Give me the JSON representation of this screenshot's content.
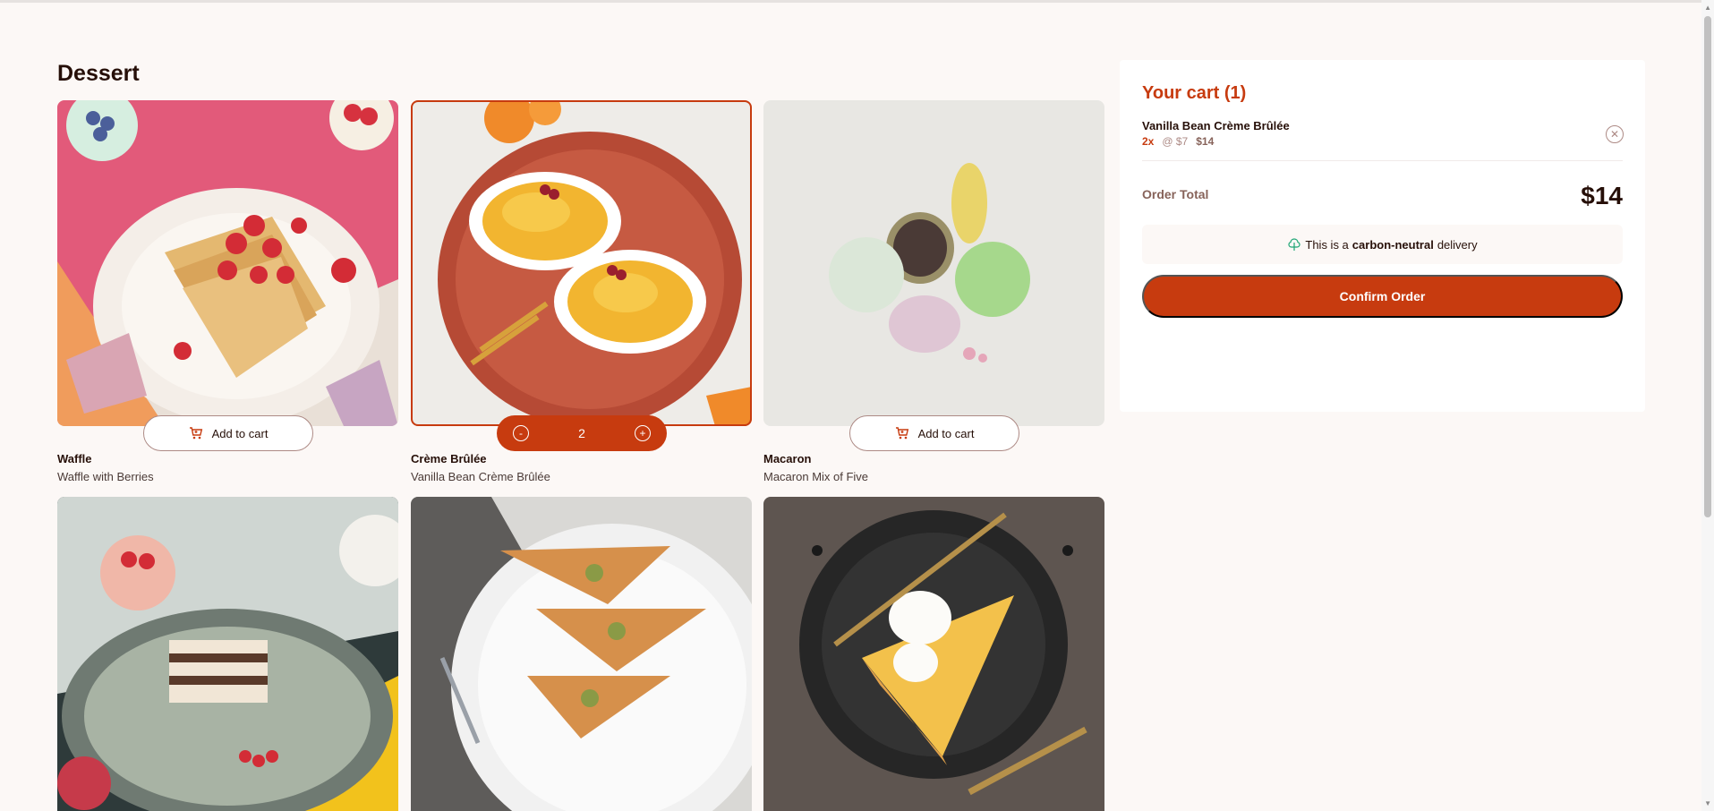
{
  "page": {
    "title": "Dessert"
  },
  "products": [
    {
      "category": "Waffle",
      "name": "Waffle with Berries",
      "button_label": "Add to cart"
    },
    {
      "category": "Crème Brûlée",
      "name": "Vanilla Bean Crème Brûlée",
      "quantity": "2",
      "decrement": "-",
      "increment": "+"
    },
    {
      "category": "Macaron",
      "name": "Macaron Mix of Five",
      "button_label": "Add to cart"
    }
  ],
  "cart": {
    "title": "Your cart (1)",
    "items": [
      {
        "name": "Vanilla Bean Crème Brûlée",
        "quantity": "2x",
        "unit_price": "@ $7",
        "subtotal": "$14"
      }
    ],
    "order_total_label": "Order Total",
    "order_total_value": "$14",
    "carbon_prefix": "This is a",
    "carbon_bold": "carbon-neutral",
    "carbon_suffix": "delivery",
    "confirm_label": "Confirm Order"
  },
  "icons": [
    "cart-icon",
    "remove-icon",
    "tree-icon",
    "minus-icon",
    "plus-icon"
  ],
  "colors": {
    "accent": "#c73b0f",
    "background": "#fcf8f6",
    "text": "#260f08",
    "muted": "#87635a"
  }
}
